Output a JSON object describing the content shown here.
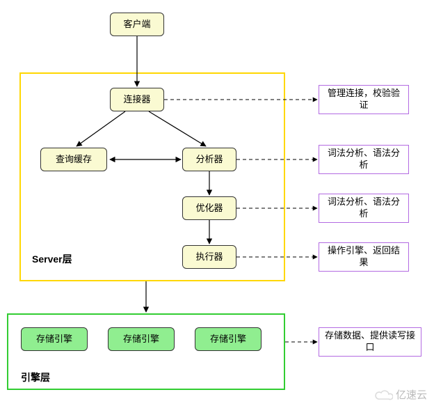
{
  "nodes": {
    "client": "客户端",
    "connector": "连接器",
    "cache": "查询缓存",
    "parser": "分析器",
    "optimizer": "优化器",
    "executor": "执行器",
    "engine1": "存储引擎",
    "engine2": "存储引擎",
    "engine3": "存储引擎"
  },
  "notes": {
    "connector_note": "管理连接，校验验证",
    "parser_note": "词法分析、语法分析",
    "optimizer_note": "词法分析、语法分析",
    "executor_note": "操作引擎、返回结果",
    "engine_note": "存储数据、提供读写接口"
  },
  "layers": {
    "server": "Server层",
    "engine": "引擎层"
  },
  "watermark": "亿速云"
}
